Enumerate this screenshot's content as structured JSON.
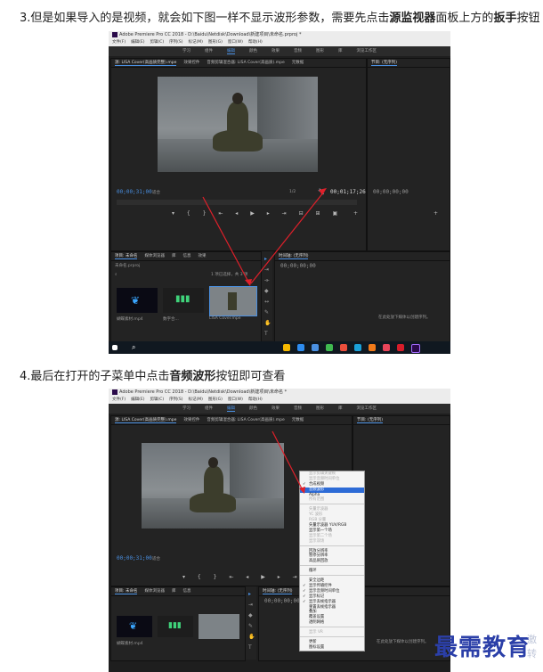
{
  "step3": {
    "prefix": "3.但是如果导入的是视频，就会如下图一样不显示波形参数，需要先点击",
    "bold1": "源监视器",
    "middle": "面板上方的",
    "bold2": "扳手",
    "suffix": "按钮"
  },
  "step4": {
    "prefix": "4.最后在打开的子菜单中点击",
    "bold1": "音频波形",
    "suffix": "按钮即可查看"
  },
  "app": {
    "title1": "Adobe Premiere Pro CC 2018 - D:\\Baidu\\Netdisk\\Download\\新建项目\\未命名.prproj *",
    "title2": "Adobe Premiere Pro CC 2018 - D:\\Baidu\\Netdisk\\Download\\新建项目\\未命名 *",
    "menu": [
      "文件(F)",
      "编辑(E)",
      "剪辑(C)",
      "序列(S)",
      "标记(M)",
      "图形(G)",
      "窗口(W)",
      "帮助(H)"
    ],
    "workspaces": [
      "学习",
      "组件",
      "编辑",
      "颜色",
      "效果",
      "音频",
      "图形",
      "库",
      "浏览工作区"
    ],
    "source_tabs": [
      "源: LISA Cover(高画质完整).mpe",
      "效果控件",
      "音频剪辑混合器: LISA Cover(高画质).mpe",
      "元数据"
    ],
    "program_tab": "节目: (无序列)",
    "source_tc": "00;00;31;00",
    "fit": "适合",
    "zoom": "1/2",
    "duration_tc": "00;01;17;26",
    "program_tc": "00;00;00;00",
    "project_tabs": [
      "项目: 未命名",
      "媒体浏览器",
      "库",
      "信息",
      "效果"
    ],
    "project_path": "未命名.prproj",
    "items_selected": "1 项已选择，共 3 项",
    "clip1": "蝴蝶素材.mp4",
    "clip2": "数字合...",
    "clip3": "LISA Cover.mpe",
    "timeline_tab": "时间轴: (无序列)",
    "timeline_msg": "在此处放下媒体以创建序列。",
    "context_menu": [
      {
        "label": "显示剪辑关键帧",
        "state": "disabled"
      },
      {
        "label": "显示音频时间单位",
        "state": "disabled"
      },
      {
        "label": "合成视频",
        "state": "check"
      },
      {
        "label": "音频波形",
        "state": "highlight"
      },
      {
        "label": "Alpha",
        "state": ""
      },
      {
        "label": "所有范围",
        "state": "disabled"
      },
      {
        "label": "",
        "state": ""
      },
      {
        "label": "矢量示波器",
        "state": "disabled"
      },
      {
        "label": "YC 波形",
        "state": "disabled"
      },
      {
        "label": "RGB 分量",
        "state": "disabled"
      },
      {
        "label": "矢量示波器 YUV/RGB",
        "state": ""
      },
      {
        "label": "显示第一个场",
        "state": ""
      },
      {
        "label": "显示第二个场",
        "state": "disabled"
      },
      {
        "label": "显示双场",
        "state": "disabled"
      },
      {
        "label": "",
        "state": ""
      },
      {
        "label": "回放分辨率",
        "state": ""
      },
      {
        "label": "暂停分辨率",
        "state": ""
      },
      {
        "label": "高品质回放",
        "state": ""
      },
      {
        "label": "",
        "state": ""
      },
      {
        "label": "循环",
        "state": ""
      },
      {
        "label": "",
        "state": ""
      },
      {
        "label": "安全边距",
        "state": ""
      },
      {
        "label": "显示传输控件",
        "state": "check"
      },
      {
        "label": "显示音频时间单位",
        "state": "check"
      },
      {
        "label": "显示标记",
        "state": "check"
      },
      {
        "label": "显示丢帧指示器",
        "state": "check"
      },
      {
        "label": "重置丢帧指示器",
        "state": ""
      },
      {
        "label": "叠加",
        "state": ""
      },
      {
        "label": "覆盖设置",
        "state": ""
      },
      {
        "label": "透明网格",
        "state": ""
      },
      {
        "label": "",
        "state": ""
      },
      {
        "label": "显示 VR",
        "state": "disabled"
      },
      {
        "label": "",
        "state": ""
      },
      {
        "label": "更新",
        "state": ""
      },
      {
        "label": "图标设置",
        "state": ""
      }
    ]
  },
  "watermark": {
    "main": "最需教育",
    "side1": "激",
    "side2": "转"
  }
}
